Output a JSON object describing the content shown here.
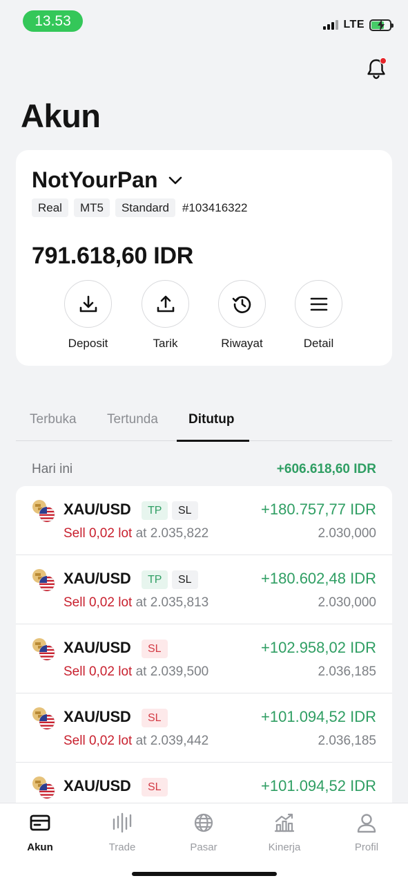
{
  "status_bar": {
    "time": "13.53",
    "network": "LTE"
  },
  "page": {
    "title": "Akun"
  },
  "account": {
    "name": "NotYourPan",
    "tags": [
      "Real",
      "MT5",
      "Standard"
    ],
    "number": "#103416322",
    "balance": "791.618,60 IDR",
    "actions": [
      {
        "label": "Deposit",
        "icon": "download-icon"
      },
      {
        "label": "Tarik",
        "icon": "upload-icon"
      },
      {
        "label": "Riwayat",
        "icon": "history-icon"
      },
      {
        "label": "Detail",
        "icon": "menu-icon"
      }
    ]
  },
  "tabs": [
    {
      "label": "Terbuka",
      "active": false
    },
    {
      "label": "Tertunda",
      "active": false
    },
    {
      "label": "Ditutup",
      "active": true
    }
  ],
  "day_group": {
    "label": "Hari ini",
    "total": "+606.618,60 IDR"
  },
  "trades": [
    {
      "symbol": "XAU/USD",
      "badges": [
        "TP",
        "SL"
      ],
      "side": "Sell 0,02 lot",
      "at": "at 2.035,822",
      "pnl": "+180.757,77 IDR",
      "close": "2.030,000"
    },
    {
      "symbol": "XAU/USD",
      "badges": [
        "TP",
        "SL"
      ],
      "side": "Sell 0,02 lot",
      "at": "at 2.035,813",
      "pnl": "+180.602,48 IDR",
      "close": "2.030,000"
    },
    {
      "symbol": "XAU/USD",
      "badges": [
        "SL"
      ],
      "side": "Sell 0,02 lot",
      "at": "at 2.039,500",
      "pnl": "+102.958,02 IDR",
      "close": "2.036,185"
    },
    {
      "symbol": "XAU/USD",
      "badges": [
        "SL"
      ],
      "side": "Sell 0,02 lot",
      "at": "at 2.039,442",
      "pnl": "+101.094,52 IDR",
      "close": "2.036,185"
    },
    {
      "symbol": "XAU/USD",
      "badges": [
        "SL"
      ],
      "side": "",
      "at": "",
      "pnl": "+101.094,52 IDR",
      "close": ""
    }
  ],
  "bottom_nav": [
    {
      "label": "Akun",
      "icon": "wallet-icon",
      "active": true
    },
    {
      "label": "Trade",
      "icon": "candles-icon",
      "active": false
    },
    {
      "label": "Pasar",
      "icon": "globe-icon",
      "active": false
    },
    {
      "label": "Kinerja",
      "icon": "chart-icon",
      "active": false
    },
    {
      "label": "Profil",
      "icon": "user-icon",
      "active": false
    }
  ],
  "colors": {
    "accent_green": "#2f9e63",
    "sell_red": "#c8202e",
    "status_green": "#34c759"
  }
}
